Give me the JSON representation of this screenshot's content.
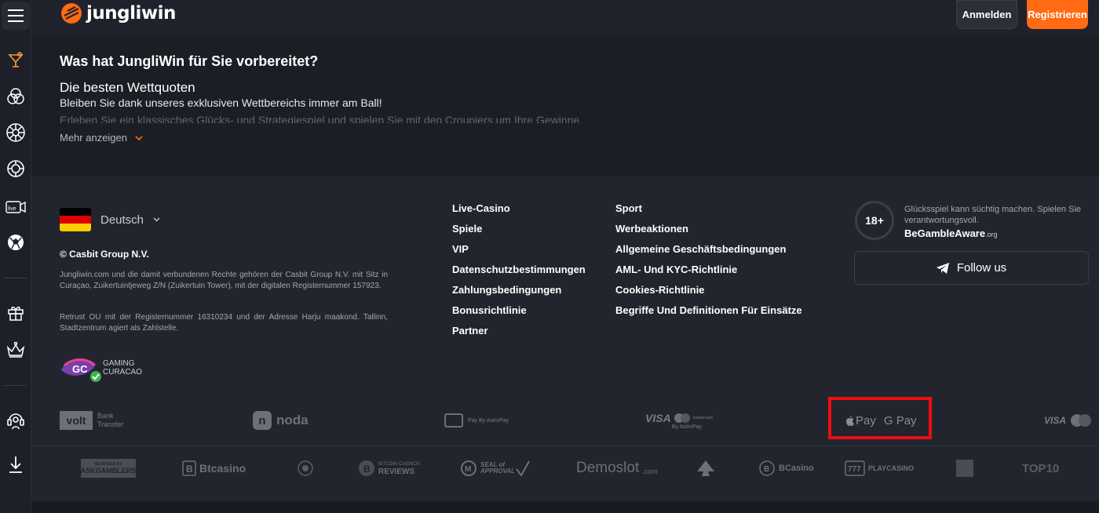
{
  "header": {
    "logo_text": "jungliwin",
    "login_label": "Anmelden",
    "register_label": "Registrieren"
  },
  "sidebar": {
    "icons": [
      "menu-icon",
      "cocktail-icon",
      "casino-chips-icon",
      "roulette-icon",
      "poker-chip-icon",
      "live-camera-icon",
      "football-icon",
      "gift-icon",
      "crown-icon",
      "support-headset-icon",
      "download-icon"
    ],
    "live_label": "live"
  },
  "info": {
    "title": "Was hat JungliWin für Sie vorbereitet?",
    "subtitle": "Die besten Wettquoten",
    "paragraph1": "Bleiben Sie dank unseres exklusiven Wettbereichs immer am Ball!",
    "paragraph2": "Erleben Sie ein klassisches Glücks- und Strategiespiel und spielen Sie mit den Croupiers um Ihre Gewinne.",
    "more_label": "Mehr anzeigen"
  },
  "footer": {
    "language": "Deutsch",
    "copyright": "© Casbit Group N.V.",
    "legal1": "Jungliwin.com und die damit verbundenen Rechte gehören der Casbit Group N.V. mit Sitz in Curaçao, Zuikertuintjeweg Z/N (Zuikertuin Tower), mit der digitalen Registernummer 157923.",
    "legal2": "Retrust OU mit der Registernummer 16310234 und der Adresse Harju maakond. Tallinn, Stadtzentrum agiert als Zahlstelle.",
    "gc_logo": {
      "initials": "GC",
      "line1": "GAMING",
      "line2": "CURACAO"
    },
    "links_col1": [
      "Live-Casino",
      "Spiele",
      "VIP",
      "Datenschutzbestimmungen",
      "Zahlungsbedingungen",
      "Bonusrichtlinie",
      "Partner"
    ],
    "links_col2": [
      "Sport",
      "Werbeaktionen",
      "Allgemeine Geschäftsbedingungen",
      "AML- Und KYC-Richtlinie",
      "Cookies-Richtlinie",
      "Begriffe Und Definitionen Für Einsätze"
    ],
    "age_badge": "18+",
    "gamble_warning": "Glücksspiel kann süchtig machen. Spielen Sie verantwortungsvoll.",
    "begambleaware": "BeGambleAware",
    "begambleaware_org": ".org",
    "follow_label": "Follow us"
  },
  "payments": {
    "volt": "volt",
    "volt_sub1": "Bank",
    "volt_sub2": "Transfer",
    "noda": "noda",
    "astropay_label": "Pay By AstroPay",
    "visa_mc_label": "VISA",
    "visa_mc_sub": "By AstroPay",
    "mastercard_label": "mastercard",
    "apple_pay": "Pay",
    "google_pay": "G Pay",
    "visa_last": "VISA"
  },
  "partners": {
    "askgamblers_top": "REVIEWED BY",
    "askgamblers": "ASKGAMBLERS",
    "btcasino": "Btcasino",
    "bitcoin_reviews_top": "BITCOIN CASINOS",
    "bitcoin_reviews": "REVIEWS",
    "seal": "SEAL of APPROVAL",
    "demoslot": "Demoslot",
    "demoslot_suffix": ".com",
    "bcasino": "BCasino",
    "playcasino": "PLAYCASINO",
    "top10": "TOP10"
  },
  "colors": {
    "accent": "#ff6a13",
    "highlight": "#ee0d12",
    "background": "#22252d"
  }
}
